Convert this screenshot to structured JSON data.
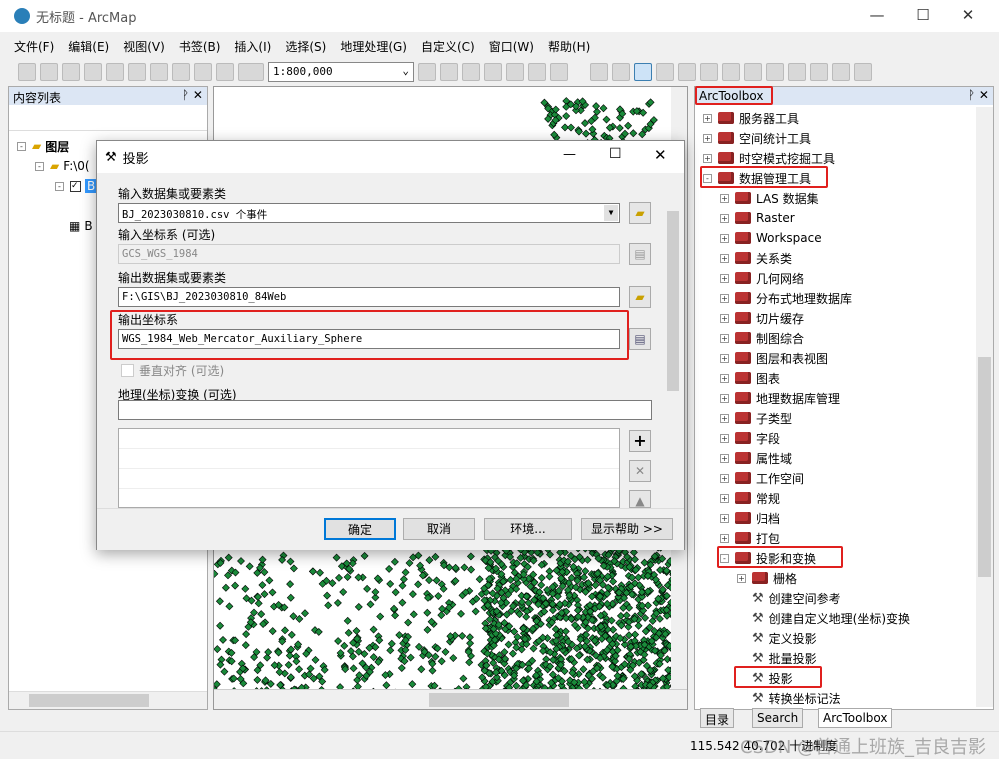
{
  "window": {
    "title": "无标题 - ArcMap"
  },
  "menu": [
    "文件(F)",
    "编辑(E)",
    "视图(V)",
    "书签(B)",
    "插入(I)",
    "选择(S)",
    "地理处理(G)",
    "自定义(C)",
    "窗口(W)",
    "帮助(H)"
  ],
  "toolbar": {
    "scale": "1:800,000"
  },
  "toc": {
    "title": "内容列表",
    "layers_label": "图层",
    "folder": "F:\\0(",
    "layer": "B",
    "layer2": "B"
  },
  "toolbox": {
    "title": "ArcToolbox",
    "items": [
      {
        "label": "服务器工具",
        "level": 0,
        "type": "box",
        "exp": "+"
      },
      {
        "label": "空间统计工具",
        "level": 0,
        "type": "box",
        "exp": "+"
      },
      {
        "label": "时空模式挖掘工具",
        "level": 0,
        "type": "box",
        "exp": "+"
      },
      {
        "label": "数据管理工具",
        "level": 0,
        "type": "box",
        "exp": "-"
      },
      {
        "label": "LAS 数据集",
        "level": 1,
        "type": "box",
        "exp": "+"
      },
      {
        "label": "Raster",
        "level": 1,
        "type": "box",
        "exp": "+"
      },
      {
        "label": "Workspace",
        "level": 1,
        "type": "box",
        "exp": "+"
      },
      {
        "label": "关系类",
        "level": 1,
        "type": "box",
        "exp": "+"
      },
      {
        "label": "几何网络",
        "level": 1,
        "type": "box",
        "exp": "+"
      },
      {
        "label": "分布式地理数据库",
        "level": 1,
        "type": "box",
        "exp": "+"
      },
      {
        "label": "切片缓存",
        "level": 1,
        "type": "box",
        "exp": "+"
      },
      {
        "label": "制图综合",
        "level": 1,
        "type": "box",
        "exp": "+"
      },
      {
        "label": "图层和表视图",
        "level": 1,
        "type": "box",
        "exp": "+"
      },
      {
        "label": "图表",
        "level": 1,
        "type": "box",
        "exp": "+"
      },
      {
        "label": "地理数据库管理",
        "level": 1,
        "type": "box",
        "exp": "+"
      },
      {
        "label": "子类型",
        "level": 1,
        "type": "box",
        "exp": "+"
      },
      {
        "label": "字段",
        "level": 1,
        "type": "box",
        "exp": "+"
      },
      {
        "label": "属性域",
        "level": 1,
        "type": "box",
        "exp": "+"
      },
      {
        "label": "工作空间",
        "level": 1,
        "type": "box",
        "exp": "+"
      },
      {
        "label": "常规",
        "level": 1,
        "type": "box",
        "exp": "+"
      },
      {
        "label": "归档",
        "level": 1,
        "type": "box",
        "exp": "+"
      },
      {
        "label": "打包",
        "level": 1,
        "type": "box",
        "exp": "+"
      },
      {
        "label": "投影和变换",
        "level": 1,
        "type": "box",
        "exp": "-"
      },
      {
        "label": "栅格",
        "level": 2,
        "type": "box",
        "exp": "+"
      },
      {
        "label": "创建空间参考",
        "level": 2,
        "type": "tool"
      },
      {
        "label": "创建自定义地理(坐标)变换",
        "level": 2,
        "type": "tool"
      },
      {
        "label": "定义投影",
        "level": 2,
        "type": "tool"
      },
      {
        "label": "批量投影",
        "level": 2,
        "type": "tool"
      },
      {
        "label": "投影",
        "level": 2,
        "type": "tool"
      },
      {
        "label": "转换坐标记法",
        "level": 2,
        "type": "tool"
      }
    ],
    "tabs": [
      "目录",
      "Search",
      "ArcToolbox"
    ]
  },
  "dialog": {
    "title": "投影",
    "input_label": "输入数据集或要素类",
    "input_value": "BJ_2023030810.csv 个事件",
    "incs_label": "输入坐标系 (可选)",
    "incs_value": "GCS_WGS_1984",
    "output_label": "输出数据集或要素类",
    "output_value": "F:\\GIS\\BJ_2023030810_84Web",
    "outcs_label": "输出坐标系",
    "outcs_value": "WGS_1984_Web_Mercator_Auxiliary_Sphere",
    "vertical_label": "垂直对齐 (可选)",
    "geo_label": "地理(坐标)变换 (可选)",
    "buttons": {
      "ok": "确定",
      "cancel": "取消",
      "env": "环境...",
      "help": "显示帮助 >>"
    }
  },
  "status": {
    "coords": "115.542 40.702 十进制度",
    "watermark": "CSDN @普通上班族_吉良吉影"
  },
  "colors": {
    "highlight": "#e0201e",
    "points": "#1a8a3a"
  }
}
